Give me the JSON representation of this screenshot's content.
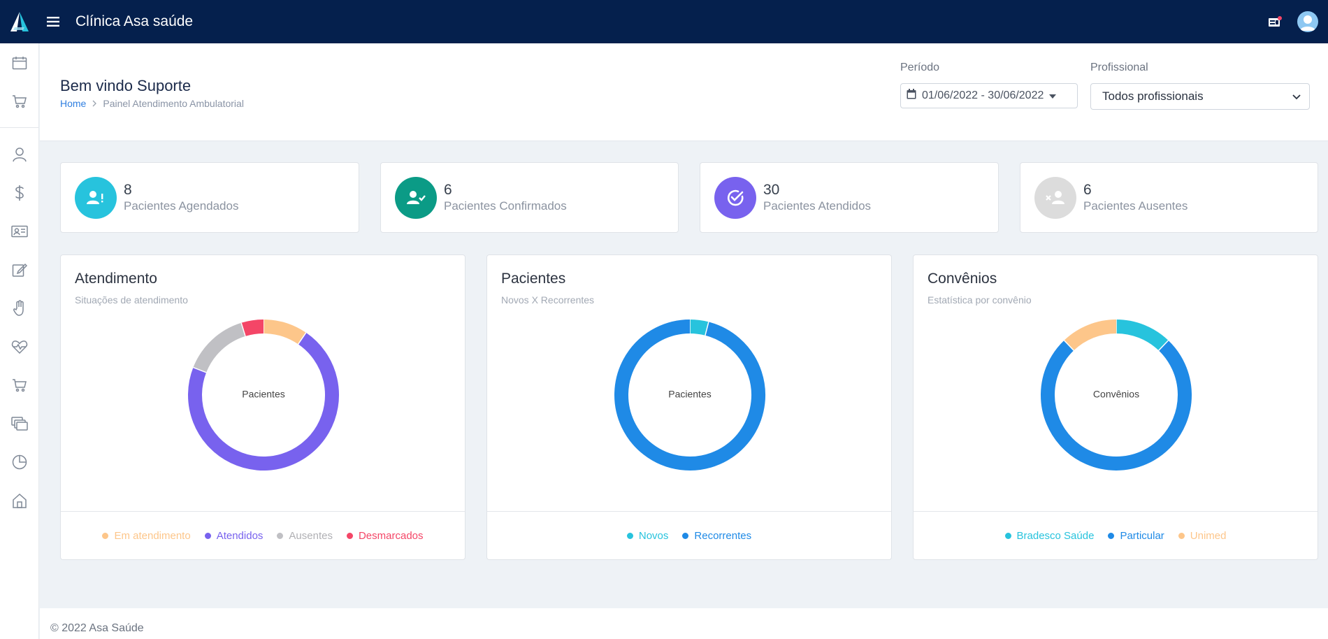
{
  "app": {
    "title": "Clínica Asa saúde"
  },
  "colors": {
    "topbar": "#05204d",
    "accent_blue": "#2f7fe0",
    "teal": "#27c3dd",
    "green": "#0b9b86",
    "purple": "#7862ee",
    "grey": "#dcdcdc",
    "orange": "#fdc68a",
    "red": "#f44667",
    "donut_blue": "#1f8ae6",
    "donut_grey": "#c0c0c4"
  },
  "header": {
    "welcome": "Bem vindo Suporte",
    "breadcrumb": {
      "home": "Home",
      "current": "Painel Atendimento Ambulatorial"
    },
    "periodo_label": "Período",
    "periodo_value": "01/06/2022 - 30/06/2022",
    "profissional_label": "Profissional",
    "profissional_value": "Todos profissionais"
  },
  "sidebar": {
    "icons": [
      "calendar-icon",
      "cart-settings-icon",
      "user-icon",
      "dollar-icon",
      "id-card-icon",
      "edit-icon",
      "hand-icon",
      "heart-pulse-icon",
      "shopping-cart-icon",
      "stack-icon",
      "pie-chart-icon",
      "home-icon"
    ]
  },
  "stats": [
    {
      "value": "8",
      "label": "Pacientes Agendados",
      "icon": "user-alert-icon",
      "color": "#27c3dd"
    },
    {
      "value": "6",
      "label": "Pacientes Confirmados",
      "icon": "user-check-icon",
      "color": "#0b9b86"
    },
    {
      "value": "30",
      "label": "Pacientes Atendidos",
      "icon": "check-circle-icon",
      "color": "#7862ee"
    },
    {
      "value": "6",
      "label": "Pacientes Ausentes",
      "icon": "user-x-icon",
      "color": "#dcdcdc"
    }
  ],
  "chart_data": [
    {
      "type": "pie",
      "title": "Atendimento",
      "subtitle": "Situações de atendimento",
      "center_label": "Pacientes",
      "categories": [
        "Em atendimento",
        "Atendidos",
        "Ausentes",
        "Desmarcados"
      ],
      "values": [
        4,
        30,
        6,
        2
      ],
      "colors": [
        "#fdc68a",
        "#7862ee",
        "#c0c0c4",
        "#f44667"
      ],
      "legend": "bottom"
    },
    {
      "type": "pie",
      "title": "Pacientes",
      "subtitle": "Novos X Recorrentes",
      "center_label": "Pacientes",
      "categories": [
        "Novos",
        "Recorrentes"
      ],
      "values": [
        1,
        24
      ],
      "colors": [
        "#27c3dd",
        "#1f8ae6"
      ],
      "legend": "bottom"
    },
    {
      "type": "pie",
      "title": "Convênios",
      "subtitle": "Estatística por convênio",
      "center_label": "Convênios",
      "categories": [
        "Bradesco Saúde",
        "Particular",
        "Unimed"
      ],
      "values": [
        4,
        25,
        4
      ],
      "colors": [
        "#27c3dd",
        "#1f8ae6",
        "#fdc68a"
      ],
      "legend": "bottom"
    }
  ],
  "footer": {
    "text": "© 2022 Asa Saúde"
  }
}
